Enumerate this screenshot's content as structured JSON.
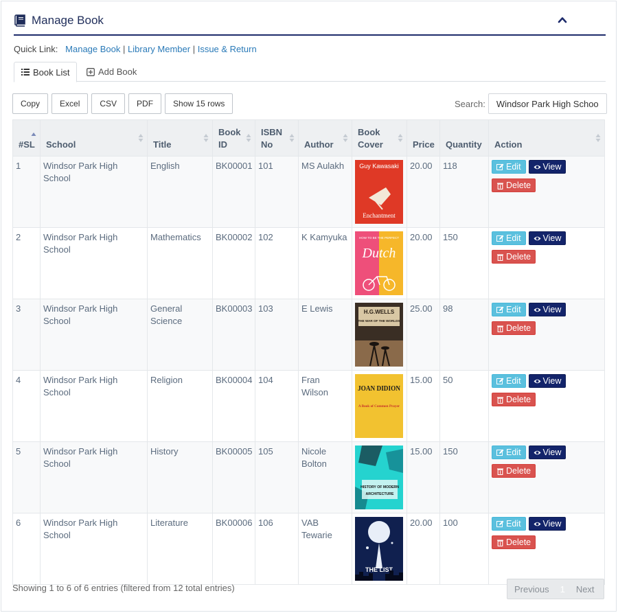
{
  "header": {
    "title": "Manage Book"
  },
  "quicklinks": {
    "label": "Quick Link:",
    "links": [
      "Manage Book",
      "Library Member",
      "Issue & Return"
    ],
    "separator": "|"
  },
  "tabs": [
    {
      "label": "Book List",
      "icon": "list-icon",
      "active": true
    },
    {
      "label": "Add Book",
      "icon": "plus-square-icon",
      "active": false
    }
  ],
  "toolbar": {
    "buttons": [
      "Copy",
      "Excel",
      "CSV",
      "PDF",
      "Show 15 rows"
    ],
    "search_label": "Search:",
    "search_value": "Windsor Park High School"
  },
  "table": {
    "columns": [
      "#SL",
      "School",
      "Title",
      "Book ID",
      "ISBN No",
      "Author",
      "Book Cover",
      "Price",
      "Quantity",
      "Action"
    ],
    "rows": [
      {
        "sl": "1",
        "school": "Windsor Park High School",
        "title": "English",
        "book_id": "BK00001",
        "isbn": "101",
        "author": "MS Aulakh",
        "cover": {
          "top": "Guy Kawasaki",
          "bottom": "Enchantment"
        },
        "price": "20.00",
        "quantity": "118"
      },
      {
        "sl": "2",
        "school": "Windsor Park High School",
        "title": "Mathematics",
        "book_id": "BK00002",
        "isbn": "102",
        "author": "K Kamyuka",
        "cover": {
          "top": "HOW TO BE THE PERFECT",
          "bottom": "Dutch"
        },
        "price": "20.00",
        "quantity": "150"
      },
      {
        "sl": "3",
        "school": "Windsor Park High School",
        "title": "General Science",
        "book_id": "BK00003",
        "isbn": "103",
        "author": "E Lewis",
        "cover": {
          "top": "H.G.WELLS",
          "bottom": "THE WAR OF THE WORLDS"
        },
        "price": "25.00",
        "quantity": "98"
      },
      {
        "sl": "4",
        "school": "Windsor Park High School",
        "title": "Religion",
        "book_id": "BK00004",
        "isbn": "104",
        "author": "Fran Wilson",
        "cover": {
          "top": "JOAN DIDION",
          "bottom": "A Book of Common Prayer"
        },
        "price": "15.00",
        "quantity": "50"
      },
      {
        "sl": "5",
        "school": "Windsor Park High School",
        "title": "History",
        "book_id": "BK00005",
        "isbn": "105",
        "author": "Nicole Bolton",
        "cover": {
          "top": "HISTORY OF MODERN",
          "bottom": "ARCHITECTURE"
        },
        "price": "15.00",
        "quantity": "150"
      },
      {
        "sl": "6",
        "school": "Windsor Park High School",
        "title": "Literature",
        "book_id": "BK00006",
        "isbn": "106",
        "author": "VAB Tewarie",
        "cover": {
          "top": "",
          "bottom": "THE LIST"
        },
        "price": "20.00",
        "quantity": "100"
      }
    ],
    "actions": {
      "edit": "Edit",
      "view": "View",
      "delete": "Delete"
    }
  },
  "footer": {
    "info": "Showing 1 to 6 of 6 entries (filtered from 12 total entries)",
    "previous": "Previous",
    "page": "1",
    "next": "Next"
  },
  "colors": {
    "accent": "#1d2b6b",
    "edit": "#5bc0de",
    "view": "#13246a",
    "delete": "#d9534f",
    "link": "#2a7ab8"
  }
}
